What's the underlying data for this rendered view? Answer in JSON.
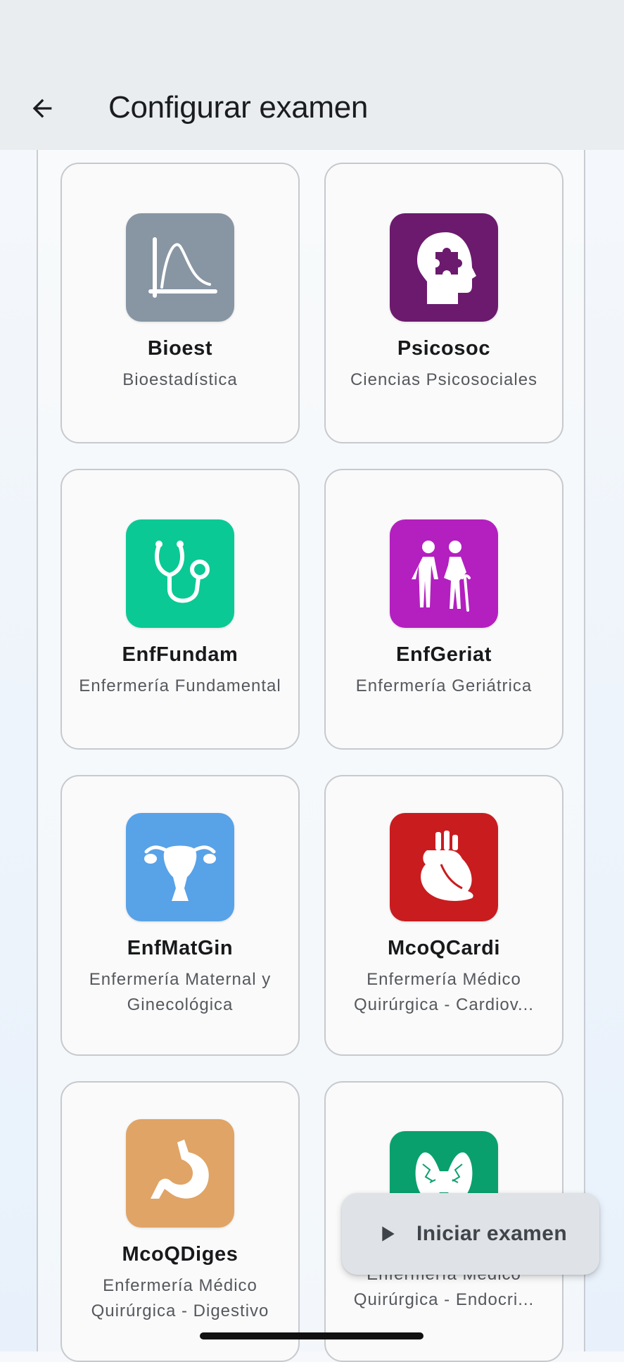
{
  "header": {
    "title": "Configurar examen"
  },
  "subjects": [
    {
      "code": "Bioest",
      "name": "Bioestadística",
      "color": "#8895a3",
      "icon": "distribution-curve-icon"
    },
    {
      "code": "Psicosoc",
      "name": "Ciencias Psicosociales",
      "color": "#6b1a6e",
      "icon": "head-puzzle-icon"
    },
    {
      "code": "EnfFundam",
      "name": "Enfermería Fundamental",
      "color": "#0bc994",
      "icon": "stethoscope-icon"
    },
    {
      "code": "EnfGeriat",
      "name": "Enfermería Geriátrica",
      "color": "#b41fc0",
      "icon": "elderly-couple-icon"
    },
    {
      "code": "EnfMatGin",
      "name": "Enfermería Maternal y Ginecológica",
      "color": "#58a2e8",
      "icon": "uterus-icon"
    },
    {
      "code": "McoQCardi",
      "name": "Enfermería Médico Quirúrgica - Cardiov...",
      "color": "#c91c1f",
      "icon": "heart-icon"
    },
    {
      "code": "McoQDiges",
      "name": "Enfermería Médico Quirúrgica - Digestivo",
      "color": "#e0a466",
      "icon": "stomach-icon"
    },
    {
      "code": "",
      "name": "Enfermería Médico Quirúrgica - Endocri...",
      "color": "#0aa06e",
      "icon": "thyroid-icon"
    }
  ],
  "fab": {
    "label": "Iniciar examen",
    "icon": "play-icon"
  }
}
